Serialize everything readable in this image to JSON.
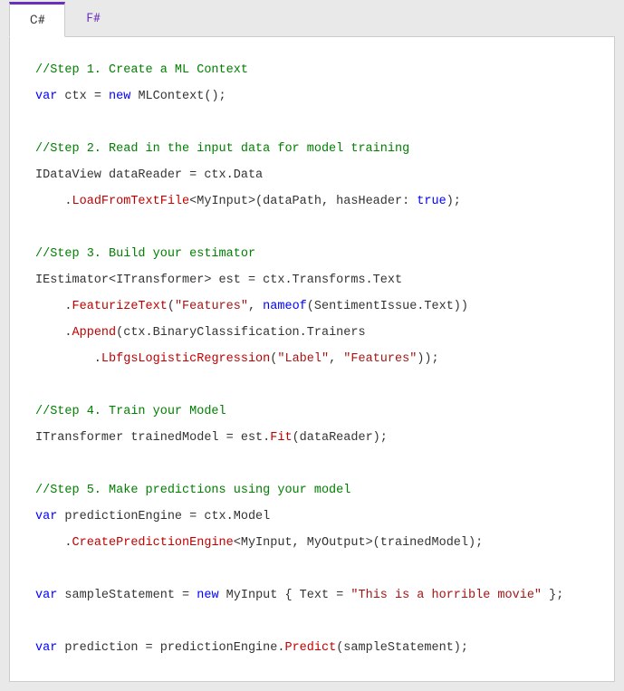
{
  "tabs": [
    {
      "label": "C#",
      "active": true
    },
    {
      "label": "F#",
      "active": false
    }
  ],
  "code": {
    "l1_comment": "//Step 1. Create a ML Context",
    "l2_kw_var": "var",
    "l2_ident": " ctx = ",
    "l2_kw_new": "new",
    "l2_call": " MLContext();",
    "l4_comment": "//Step 2. Read in the input data for model training",
    "l5": "IDataView dataReader = ctx.Data",
    "l6_pre": "    .",
    "l6_method": "LoadFromTextFile",
    "l6_post1": "<MyInput>(dataPath, hasHeader: ",
    "l6_kw": "true",
    "l6_post2": ");",
    "l8_comment": "//Step 3. Build your estimator",
    "l9": "IEstimator<ITransformer> est = ctx.Transforms.Text",
    "l10_pre": "    .",
    "l10_method": "FeaturizeText",
    "l10_open": "(",
    "l10_str1": "\"Features\"",
    "l10_comma": ", ",
    "l10_kw": "nameof",
    "l10_post": "(SentimentIssue.Text))",
    "l11_pre": "    .",
    "l11_method": "Append",
    "l11_post": "(ctx.BinaryClassification.Trainers",
    "l12_pre": "        .",
    "l12_method": "LbfgsLogisticRegression",
    "l12_open": "(",
    "l12_str1": "\"Label\"",
    "l12_comma": ", ",
    "l12_str2": "\"Features\"",
    "l12_close": "));",
    "l14_comment": "//Step 4. Train your Model",
    "l15_pre": "ITransformer trainedModel = est.",
    "l15_method": "Fit",
    "l15_post": "(dataReader);",
    "l17_comment": "//Step 5. Make predictions using your model",
    "l18_kw": "var",
    "l18_post": " predictionEngine = ctx.Model",
    "l19_pre": "    .",
    "l19_method": "CreatePredictionEngine",
    "l19_post": "<MyInput, MyOutput>(trainedModel);",
    "l21_kw_var": "var",
    "l21_mid": " sampleStatement = ",
    "l21_kw_new": "new",
    "l21_post1": " MyInput { Text = ",
    "l21_str": "\"This is a horrible movie\"",
    "l21_post2": " };",
    "l23_kw": "var",
    "l23_mid": " prediction = predictionEngine.",
    "l23_method": "Predict",
    "l23_post": "(sampleStatement);"
  }
}
